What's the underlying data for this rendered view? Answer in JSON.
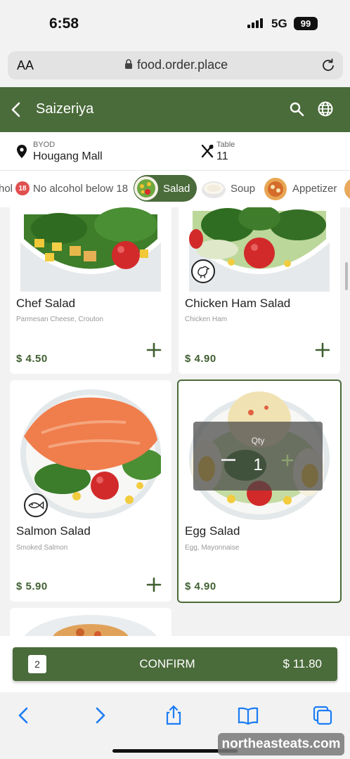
{
  "status_bar": {
    "time": "6:58",
    "network": "5G",
    "battery": "99"
  },
  "browser": {
    "text_size": "AA",
    "url": "food.order.place"
  },
  "header": {
    "title": "Saizeriya"
  },
  "info": {
    "mode_label": "BYOD",
    "location": "Hougang Mall",
    "table_label": "Table",
    "table_number": "11"
  },
  "categories": [
    {
      "label": "hol",
      "active": false
    },
    {
      "label": "No alcohol below 18",
      "badge": "18",
      "active": false
    },
    {
      "label": "Salad",
      "active": true
    },
    {
      "label": "Soup",
      "active": false
    },
    {
      "label": "Appetizer",
      "active": false
    }
  ],
  "items": [
    {
      "name": "Chef Salad",
      "description": "Parmesan Cheese, Crouton",
      "price": "$ 4.50",
      "tag_icon": null,
      "selected": false
    },
    {
      "name": "Chicken Ham Salad",
      "description": "Chicken Ham",
      "price": "$ 4.90",
      "tag_icon": "chicken-icon",
      "selected": false
    },
    {
      "name": "Salmon Salad",
      "description": "Smoked Salmon",
      "price": "$ 5.90",
      "tag_icon": "fish-icon",
      "selected": false
    },
    {
      "name": "Egg Salad",
      "description": "Egg, Mayonnaise",
      "price": "$ 4.90",
      "tag_icon": null,
      "selected": true
    }
  ],
  "quantity_popup": {
    "label": "Qty",
    "value": "1"
  },
  "cart": {
    "count": "2",
    "confirm_label": "CONFIRM",
    "total": "$ 11.80"
  },
  "watermark": "northeasteats.com",
  "colors": {
    "brand_green": "#4a6b3a",
    "price_green": "#3f5f30",
    "ios_blue": "#1a7cf5"
  }
}
